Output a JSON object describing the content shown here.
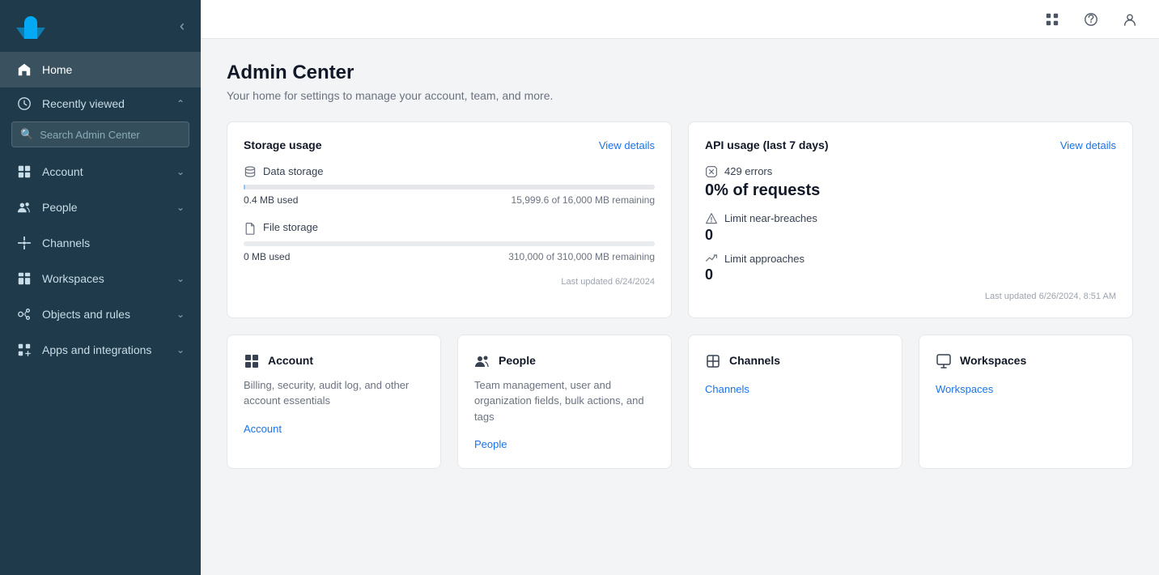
{
  "app": {
    "logo_text": "Z",
    "title": "Admin Center",
    "subtitle": "Your home for settings to manage your account, team, and more."
  },
  "sidebar": {
    "search_placeholder": "Search Admin Center",
    "items": [
      {
        "id": "home",
        "label": "Home",
        "active": true,
        "has_chevron": false
      },
      {
        "id": "recently-viewed",
        "label": "Recently viewed",
        "active": false,
        "has_chevron": true
      },
      {
        "id": "account",
        "label": "Account",
        "active": false,
        "has_chevron": true
      },
      {
        "id": "people",
        "label": "People",
        "active": false,
        "has_chevron": true
      },
      {
        "id": "channels",
        "label": "Channels",
        "active": false,
        "has_chevron": false
      },
      {
        "id": "workspaces",
        "label": "Workspaces",
        "active": false,
        "has_chevron": true
      },
      {
        "id": "objects-and-rules",
        "label": "Objects and rules",
        "active": false,
        "has_chevron": true
      },
      {
        "id": "apps-and-integrations",
        "label": "Apps and integrations",
        "active": false,
        "has_chevron": true
      }
    ]
  },
  "storage": {
    "section_title": "Storage usage",
    "view_details": "View details",
    "data_storage": {
      "label": "Data storage",
      "used": "0.4 MB used",
      "remaining": "15,999.6 of 16,000 MB remaining",
      "fill_percent": 0.003
    },
    "file_storage": {
      "label": "File storage",
      "used": "0 MB used",
      "remaining": "310,000 of 310,000 MB remaining",
      "fill_percent": 0
    },
    "last_updated": "Last updated 6/24/2024"
  },
  "api": {
    "section_title": "API usage (last 7 days)",
    "view_details": "View details",
    "errors_label": "429 errors",
    "requests_stat": "0% of requests",
    "limit_near_breaches_label": "Limit near-breaches",
    "limit_near_breaches_value": "0",
    "limit_approaches_label": "Limit approaches",
    "limit_approaches_value": "0",
    "last_updated": "Last updated 6/26/2024, 8:51 AM"
  },
  "feature_cards": [
    {
      "id": "account",
      "title": "Account",
      "description": "Billing, security, audit log, and other account essentials",
      "link_label": "Account"
    },
    {
      "id": "people",
      "title": "People",
      "description": "Team management, user and organization fields, bulk actions, and tags",
      "link_label": "People"
    },
    {
      "id": "channels",
      "title": "Channels",
      "description": "",
      "link_label": "Channels"
    },
    {
      "id": "workspaces",
      "title": "Workspaces",
      "description": "",
      "link_label": "Workspaces"
    }
  ]
}
